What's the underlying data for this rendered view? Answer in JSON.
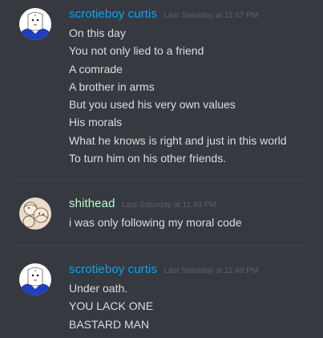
{
  "messages": [
    {
      "username": "scrotieboy curtis",
      "username_color": "#00a8fc",
      "timestamp": "Last Saturday at 11:47 PM",
      "avatar": "blue-character-avatar",
      "lines": [
        "On this day",
        "You not only lied to a friend",
        "A comrade",
        "A brother in arms",
        "But you used his very own values",
        "His morals",
        "What he knows is right and just in this world",
        "To turn him on his other friends."
      ]
    },
    {
      "username": "shithead",
      "username_color": "#b9ffd0",
      "timestamp": "Last Saturday at 11:48 PM",
      "avatar": "sketch-avatar",
      "lines": [
        "i was only following my moral code"
      ]
    },
    {
      "username": "scrotieboy curtis",
      "username_color": "#00a8fc",
      "timestamp": "Last Saturday at 11:48 PM",
      "avatar": "blue-character-avatar",
      "lines": [
        "Under oath.",
        "YOU LACK ONE",
        "BASTARD MAN"
      ]
    }
  ]
}
